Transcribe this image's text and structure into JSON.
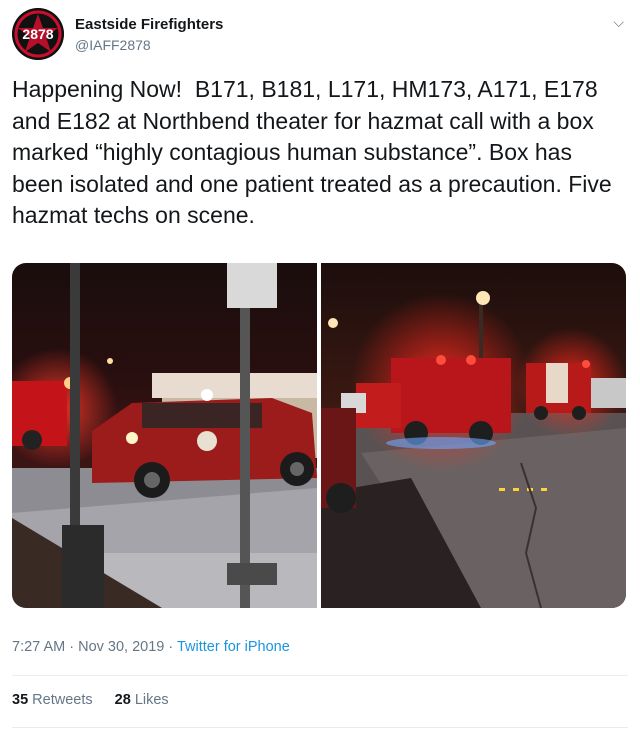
{
  "author": {
    "display_name": "Eastside Firefighters",
    "handle": "@IAFF2878",
    "avatar_number": "2878"
  },
  "menu": {
    "icon": "chevron-down-icon",
    "glyph": "⌵"
  },
  "tweet": {
    "text": "Happening Now!  B171, B181, L171, HM173, A171, E178 and E182 at Northbend theater for hazmat call with a box marked “highly contagious human substance”. Box has been isolated and one patient treated as a precaution. Five hazmat techs on scene."
  },
  "media": {
    "photos": [
      {
        "description": "Red fire command SUV with emergency lights at night in parking lot"
      },
      {
        "description": "Fire engine and ambulance with red lights in parking lot at night"
      }
    ]
  },
  "meta": {
    "time": "7:27 AM",
    "separator": " · ",
    "date": "Nov 30, 2019",
    "source": "Twitter for iPhone"
  },
  "stats": {
    "retweets_count": "35",
    "retweets_label": "Retweets",
    "likes_count": "28",
    "likes_label": "Likes"
  },
  "colors": {
    "link": "#1b95e0",
    "muted": "#657786",
    "text": "#14171a",
    "divider": "#e6ecf0"
  }
}
